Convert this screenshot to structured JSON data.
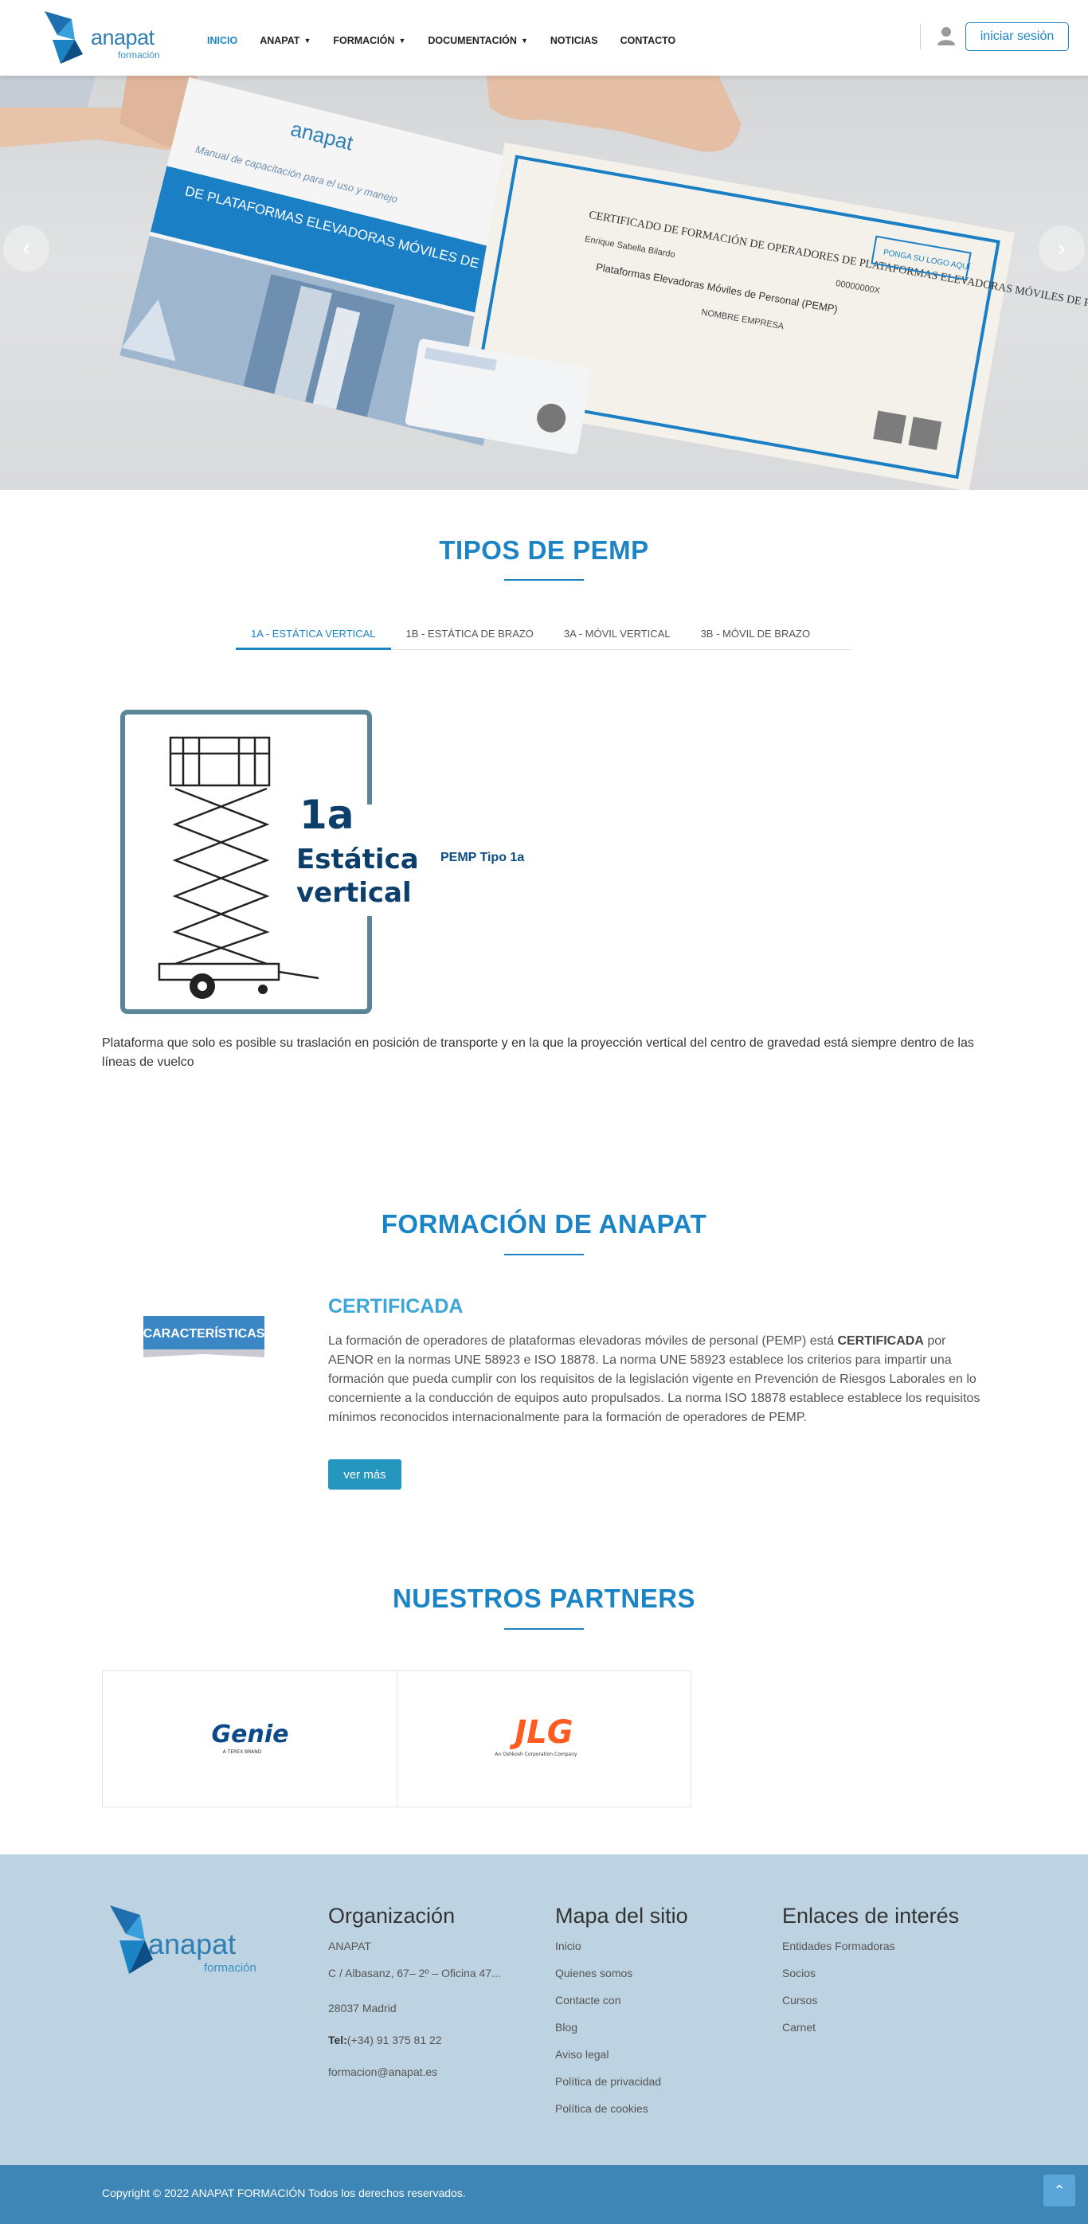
{
  "brand": {
    "logo_word": "anapat",
    "logo_sub": "formación"
  },
  "nav": {
    "items": [
      {
        "label": "INICIO",
        "dropdown": false,
        "active": true
      },
      {
        "label": "ANAPAT",
        "dropdown": true
      },
      {
        "label": "FORMACIÓN",
        "dropdown": true
      },
      {
        "label": "DOCUMENTACIÓN",
        "dropdown": true
      },
      {
        "label": "NOTICIAS",
        "dropdown": false
      },
      {
        "label": "CONTACTO",
        "dropdown": false
      }
    ],
    "login_label": "iniciar sesión"
  },
  "hero": {
    "manual_title": "Manual de capacitación para el uso y manejo",
    "manual_heading": "DE PLATAFORMAS ELEVADORAS MÓVILES DE PERSONAL",
    "cert_title": "CERTIFICADO DE FORMACIÓN DE OPERADORES DE PLATAFORMAS ELEVADORAS MÓVILES DE PERSONAL",
    "cert_name": "Enrique Sabella Bilardo",
    "cert_nif": "00000000X",
    "cert_machine": "Plataformas Elevadoras Móviles de Personal (PEMP)",
    "cert_company": "NOMBRE EMPRESA",
    "cert_logo_box": "PONGA SU LOGO AQUÍ"
  },
  "tipos": {
    "title": "TIPOS DE PEMP",
    "tabs": [
      "1A - ESTÁTICA VERTICAL",
      "1B - ESTÁTICA DE BRAZO",
      "3A - MÓVIL VERTICAL",
      "3B - MÓVIL DE BRAZO"
    ],
    "active_tab": 0,
    "image_code": "1a",
    "image_line1": "Estática",
    "image_line2": "vertical",
    "type_name": "PEMP Tipo 1a",
    "description": "Plataforma que solo es posible su traslación en posición de transporte y en la que la proyección vertical del centro de gravedad está siempre dentro de las líneas de vuelco"
  },
  "formacion": {
    "title": "FORMACIÓN DE ANAPAT",
    "image_label": "CARACTERÍSTICAS",
    "heading": "CERTIFICADA",
    "text_before": "La formación de operadores de plataformas elevadoras móviles de personal (PEMP) está ",
    "text_bold": "CERTIFICADA",
    "text_after": " por AENOR en la normas UNE 58923 e ISO 18878.  La norma UNE 58923  establece los criterios para impartir una formación que pueda cumplir con los requisitos de la legislación vigente en Prevención de Riesgos Laborales en lo concerniente a la conducción de equipos auto propulsados. La norma ISO 18878 establece establece los requisitos mínimos reconocidos internacionalmente para la formación de operadores de PEMP.",
    "button_label": "ver más"
  },
  "partners": {
    "title": "NUESTROS PARTNERS",
    "genie_name": "Genie",
    "genie_sub": "A TEREX BRAND",
    "jlg_name": "JLG",
    "jlg_sub": "An Oshkosh Corporation Company"
  },
  "footer": {
    "org": {
      "title": "Organización",
      "name": "ANAPAT",
      "address": "C / Albasanz, 67– 2º – Oficina 47...",
      "city": "28037 Madrid",
      "tel_label": "Tel:",
      "tel": "(+34) 91 375 81 22",
      "email": "formacion@anapat.es"
    },
    "sitemap": {
      "title": "Mapa del sitio",
      "links": [
        "Inicio",
        "Quienes somos",
        "Contacte con",
        "Blog",
        "Aviso legal",
        "Política de privacidad",
        "Política de cookies"
      ]
    },
    "links": {
      "title": "Enlaces de interés",
      "items": [
        "Entidades Formadoras",
        "Socios",
        "Cursos",
        "Carnet"
      ]
    },
    "copyright": "Copyright © 2022 ANAPAT FORMACIÓN Todos los derechos reservados."
  },
  "colors": {
    "primary": "#1b84c5",
    "accent": "#3ea6d6",
    "footer_bg": "#bdd3e1",
    "copyright_bg": "#3e86b5"
  }
}
